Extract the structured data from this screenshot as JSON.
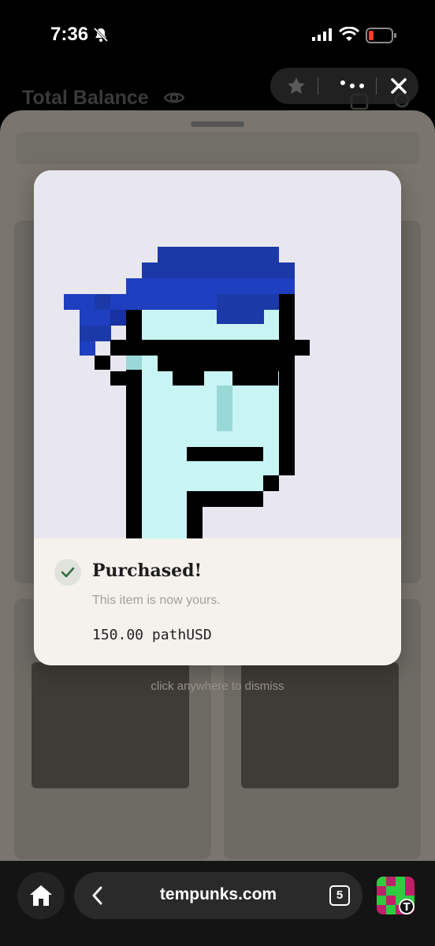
{
  "status_bar": {
    "time": "7:36"
  },
  "background": {
    "header_title": "Total Balance"
  },
  "modal": {
    "title": "Purchased!",
    "subtitle": "This item is now yours.",
    "price": "150.00 pathUSD",
    "dismiss_hint": "click anywhere to dismiss"
  },
  "browser": {
    "url": "tempunks.com",
    "tab_count": "5"
  },
  "colors": {
    "bandana": "#1e3fc0",
    "skin": "#c8f4f4",
    "nose": "#9ad8d8",
    "glasses": "#000000",
    "art_background": "#e8e6ee",
    "success": "#2e6b3e"
  }
}
